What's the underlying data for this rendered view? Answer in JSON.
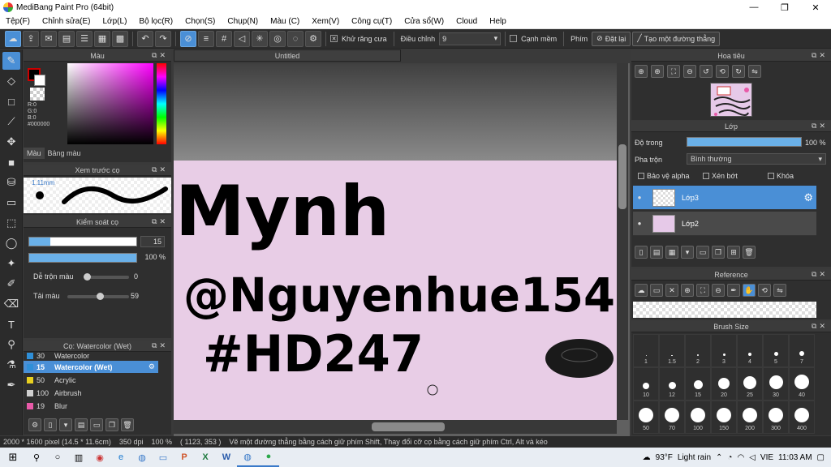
{
  "window": {
    "title": "MediBang Paint Pro (64bit)",
    "controls": [
      "—",
      "❐",
      "✕"
    ]
  },
  "menu": [
    "Tệp(F)",
    "Chỉnh sửa(E)",
    "Lớp(L)",
    "Bộ lọc(R)",
    "Chọn(S)",
    "Chụp(N)",
    "Màu (C)",
    "Xem(V)",
    "Công cụ(T)",
    "Cửa sổ(W)",
    "Cloud",
    "Help"
  ],
  "toolbar": {
    "antialias_label": "Khử răng cưa",
    "adjust_label": "Điều chỉnh",
    "adjust_value": "9",
    "edge_label": "Cạnh mềm",
    "key_label": "Phím",
    "reset_label": "Đặt lại",
    "straight_line_label": "Tạo một đường thẳng"
  },
  "color_panel": {
    "title": "Màu",
    "rgb": [
      "R:0",
      "G:0",
      "B:0",
      "#000000"
    ],
    "tabs": [
      "Màu",
      "Bảng màu"
    ],
    "foreground": "#000000",
    "background": "#ffffff"
  },
  "preview_panel": {
    "title": "Xem trước cọ",
    "size": "1.11mm"
  },
  "control_panel": {
    "title": "Kiểm soát cọ",
    "size_value": "15",
    "size_fraction": 0.2,
    "opacity_value": "100 %",
    "opacity_fraction": 1.0,
    "blend_label": "Dễ trộn màu",
    "blend_value": "0",
    "amount_label": "Tải màu",
    "amount_value": "59"
  },
  "brush_panel": {
    "title": "Cọ: Watercolor (Wet)",
    "brushes": [
      {
        "size": "30",
        "name": "Watercolor",
        "color": "#2f8fd8"
      },
      {
        "size": "15",
        "name": "Watercolor (Wet)",
        "color": "#2f8fd8",
        "active": true
      },
      {
        "size": "50",
        "name": "Acrylic",
        "color": "#e8d020"
      },
      {
        "size": "100",
        "name": "Airbrush",
        "color": "#d0d0d0"
      },
      {
        "size": "19",
        "name": "Blur",
        "color": "#e85aa8"
      }
    ]
  },
  "canvas": {
    "tab_title": "Untitled",
    "text_lines": [
      "Mynh",
      "@Nguyenhue154",
      "#HD247"
    ]
  },
  "navigator": {
    "title": "Hoa tiêu"
  },
  "layer_panel": {
    "title": "Lớp",
    "opacity_label": "Độ trong",
    "opacity_value": "100 %",
    "blend_label": "Pha trộn",
    "blend_value": "Bình thường",
    "protect_alpha": "Bảo vệ alpha",
    "clipping": "Xén bớt",
    "lock": "Khóa",
    "layers": [
      {
        "name": "Lớp3",
        "active": true
      },
      {
        "name": "Lớp2",
        "active": false
      }
    ]
  },
  "reference_panel": {
    "title": "Reference"
  },
  "brush_size_panel": {
    "title": "Brush Size",
    "sizes": [
      "1",
      "1.5",
      "2",
      "3",
      "4",
      "5",
      "7",
      "10",
      "12",
      "15",
      "20",
      "25",
      "30",
      "40",
      "50",
      "70",
      "100",
      "150",
      "200",
      "300",
      "400"
    ]
  },
  "status": {
    "dimensions": "2000 * 1600 pixel  (14.5 * 11.6cm)",
    "dpi": "350 dpi",
    "zoom": "100 %",
    "cursor": "( 1123, 353 )",
    "hint": "Vẽ một đường thẳng bằng cách giữ phím Shift, Thay đổi cỡ cọ bằng cách giữ phím Ctrl, Alt và kéo"
  },
  "taskbar": {
    "weather_temp": "93°F",
    "weather_desc": "Light rain",
    "lang": "VIE",
    "time": "11:03 AM"
  }
}
